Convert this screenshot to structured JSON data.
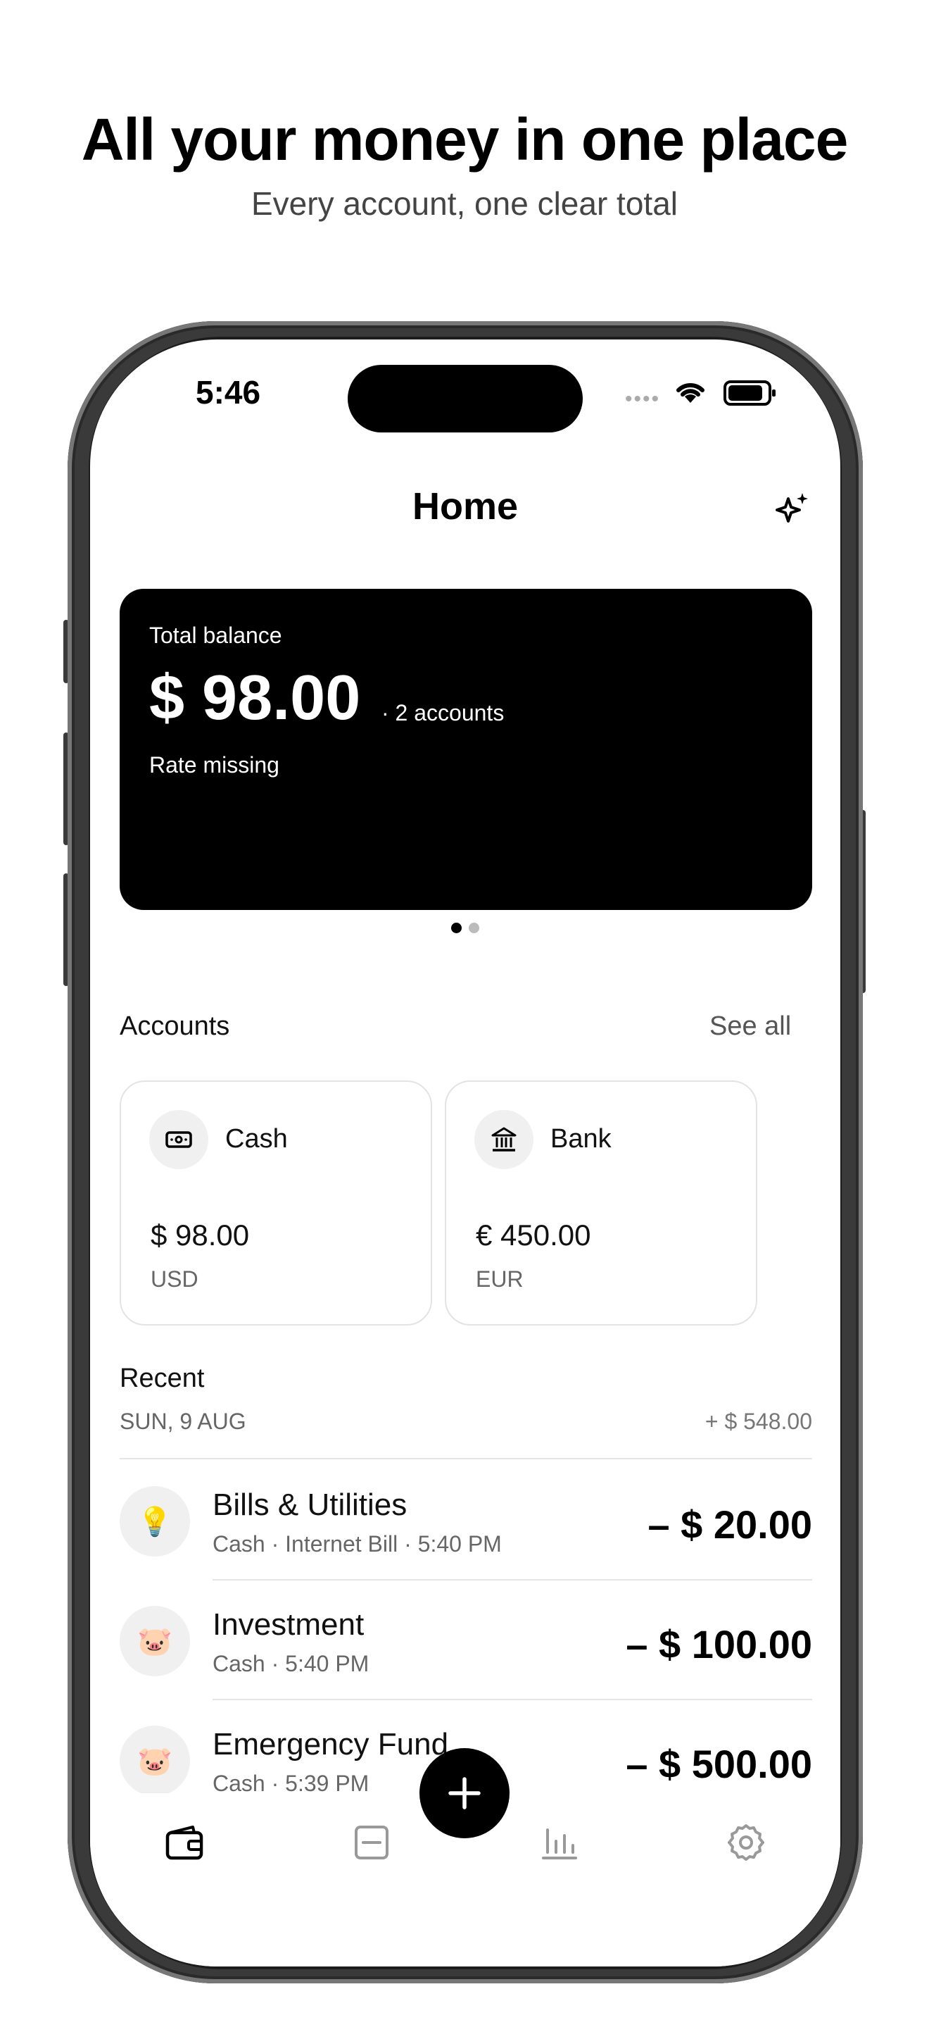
{
  "hero": {
    "title": "All your money in one place",
    "subtitle": "Every account, one clear total"
  },
  "status_bar": {
    "time": "5:46",
    "icons": [
      "signal-dots-icon",
      "wifi-icon",
      "battery-icon"
    ]
  },
  "nav": {
    "title": "Home",
    "action_icon": "sparkle-icon"
  },
  "balance_card": {
    "label": "Total balance",
    "amount": "$ 98.00",
    "accounts_note": "· 2 accounts",
    "rate_note": "Rate missing",
    "pages": 2,
    "active_page": 1
  },
  "accounts": {
    "title": "Accounts",
    "see_all": "See all",
    "items": [
      {
        "name": "Cash",
        "amount": "$ 98.00",
        "currency": "USD",
        "icon": "cash-icon"
      },
      {
        "name": "Bank",
        "amount": "€ 450.00",
        "currency": "EUR",
        "icon": "bank-icon"
      }
    ]
  },
  "recent": {
    "title": "Recent",
    "date": "SUN, 9 AUG",
    "day_total": "+ $ 548.00",
    "transactions": [
      {
        "title": "Bills & Utilities",
        "subtitle": "Cash · Internet Bill · 5:40 PM",
        "amount": "– $ 20.00",
        "icon": "lightbulb-icon",
        "glyph": "💡"
      },
      {
        "title": "Investment",
        "subtitle": "Cash · 5:40 PM",
        "amount": "– $ 100.00",
        "icon": "pig-icon",
        "glyph": "🐷"
      },
      {
        "title": "Emergency Fund",
        "subtitle": "Cash · 5:39 PM",
        "amount": "– $ 500.00",
        "icon": "pig-icon",
        "glyph": "🐷"
      }
    ]
  },
  "tabbar": {
    "items": [
      {
        "icon": "wallet-icon",
        "active": true
      },
      {
        "icon": "budget-icon",
        "active": false
      },
      {
        "icon": "stats-icon",
        "active": false
      },
      {
        "icon": "settings-icon",
        "active": false
      }
    ],
    "fab_icon": "plus-icon"
  },
  "colors": {
    "accent": "#000000",
    "muted_text": "#666666",
    "card_border": "#e3e3e3"
  }
}
